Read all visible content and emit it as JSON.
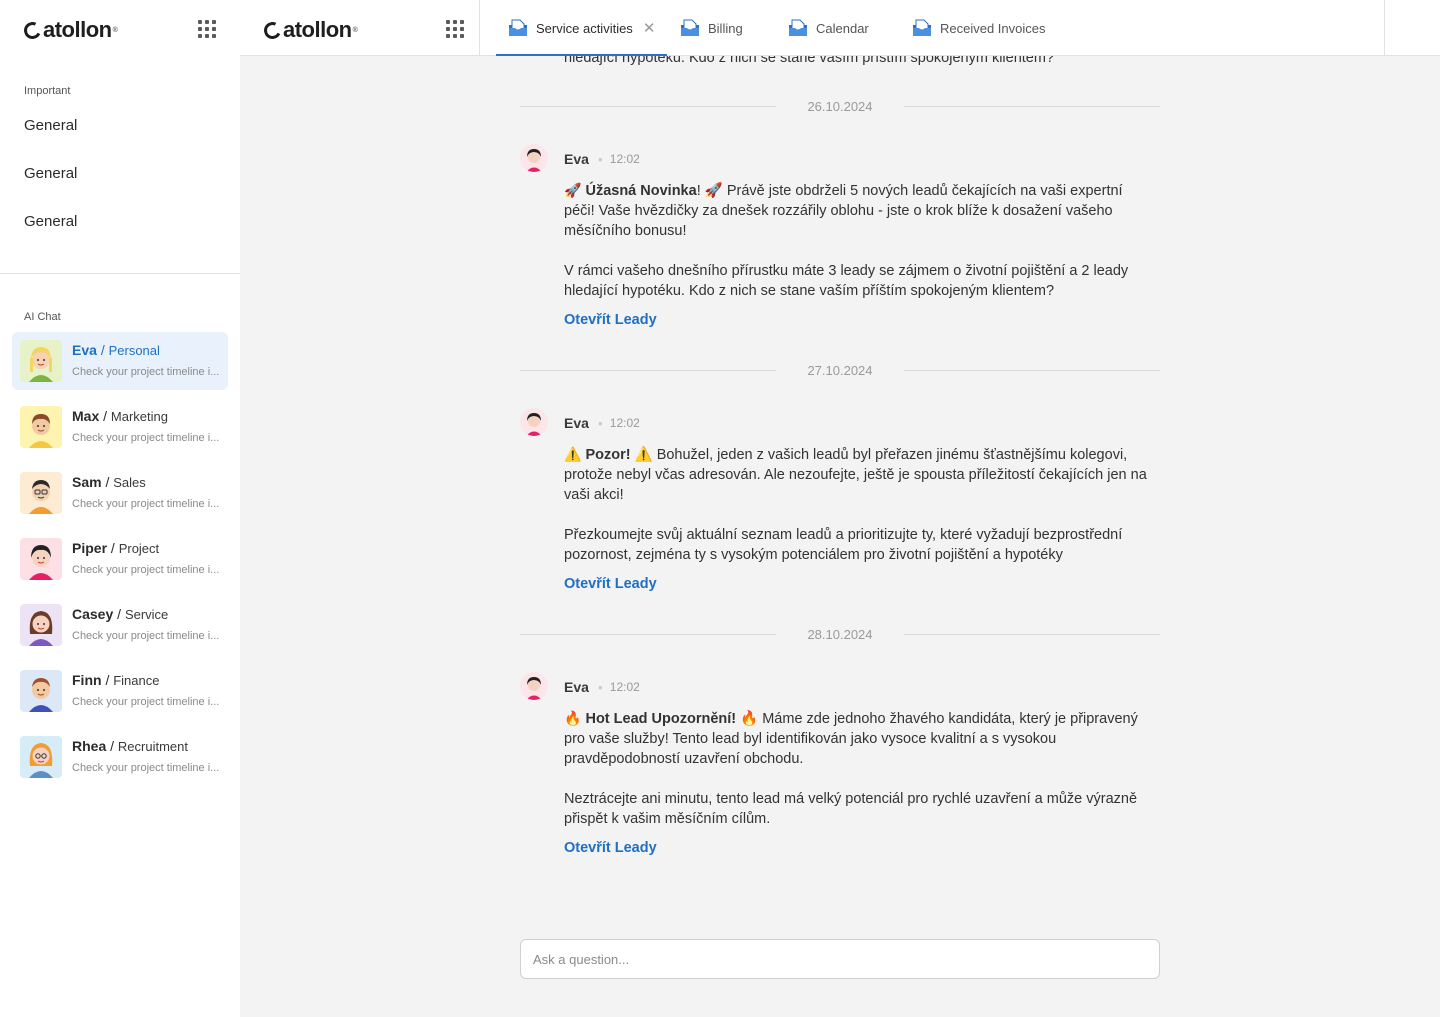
{
  "app": {
    "logo_text": "atollon"
  },
  "sidebar": {
    "important_label": "Important",
    "nav_items": [
      "General",
      "General",
      "General"
    ],
    "ai_chat_label": "AI Chat",
    "chats": [
      {
        "name": "Eva",
        "role": "Personal",
        "preview": "Check your project timeline i...",
        "active": true
      },
      {
        "name": "Max",
        "role": "Marketing",
        "preview": "Check your project timeline i..."
      },
      {
        "name": "Sam",
        "role": "Sales",
        "preview": "Check your project timeline i..."
      },
      {
        "name": "Piper",
        "role": "Project",
        "preview": "Check your project timeline i..."
      },
      {
        "name": "Casey",
        "role": "Service",
        "preview": "Check your project timeline i..."
      },
      {
        "name": "Finn",
        "role": "Finance",
        "preview": "Check your project timeline i..."
      },
      {
        "name": "Rhea",
        "role": "Recruitment",
        "preview": "Check your project timeline i..."
      }
    ]
  },
  "tabs": [
    {
      "label": "Service activities",
      "active": true,
      "closable": true
    },
    {
      "label": "Billing"
    },
    {
      "label": "Calendar"
    },
    {
      "label": "Received Invoices"
    }
  ],
  "conversation": {
    "partial_top": "hledající hypotéku. Kdo z nich se stane vaším příštím spokojeným klientem?",
    "messages": [
      {
        "date": "26.10.2024",
        "author": "Eva",
        "time": "12:02",
        "p1_bold": "Úžasná Novinka",
        "p1_rest": "! 🚀 Právě jste obdrželi 5 nových leadů čekajících na vaši expertní péči! Vaše hvězdičky za dnešek rozzářily oblohu - jste o krok blíže k dosažení vašeho měsíčního bonusu!",
        "p1_emoji": "🚀",
        "p2": "V rámci vašeho dnešního přírustku máte 3 leady se zájmem o životní pojištění a 2 leady hledající hypotéku. Kdo z nich se stane vaším příštím spokojeným klientem?",
        "link": "Otevřít Leady"
      },
      {
        "date": "27.10.2024",
        "author": "Eva",
        "time": "12:02",
        "p1_bold": "Pozor!",
        "p1_rest": " ⚠️ Bohužel, jeden z vašich leadů byl přeřazen jinému šťastnějšímu kolegovi, protože nebyl včas adresován. Ale nezoufejte, ještě je spousta příležitostí čekajících jen na vaši akci!",
        "p1_emoji": "⚠️",
        "p2": "Přezkoumejte svůj aktuální seznam leadů a prioritizujte ty, které vyžadují bezprostřední pozornost, zejména ty s vysokým potenciálem pro životní pojištění a hypotéky",
        "link": "Otevřít Leady"
      },
      {
        "date": "28.10.2024",
        "author": "Eva",
        "time": "12:02",
        "p1_bold": "Hot Lead Upozornění!",
        "p1_rest": " 🔥 Máme zde jednoho žhavého kandidáta, který je připravený pro vaše služby! Tento lead byl identifikován jako vysoce kvalitní a s vysokou pravděpodobností uzavření obchodu.",
        "p1_emoji": "🔥",
        "p2": "Neztrácejte ani minutu, tento lead má velký potenciál pro rychlé uzavření a může výrazně přispět k vašim měsíčním cílům.",
        "link": "Otevřít Leady"
      }
    ]
  },
  "input": {
    "placeholder": "Ask a question..."
  }
}
